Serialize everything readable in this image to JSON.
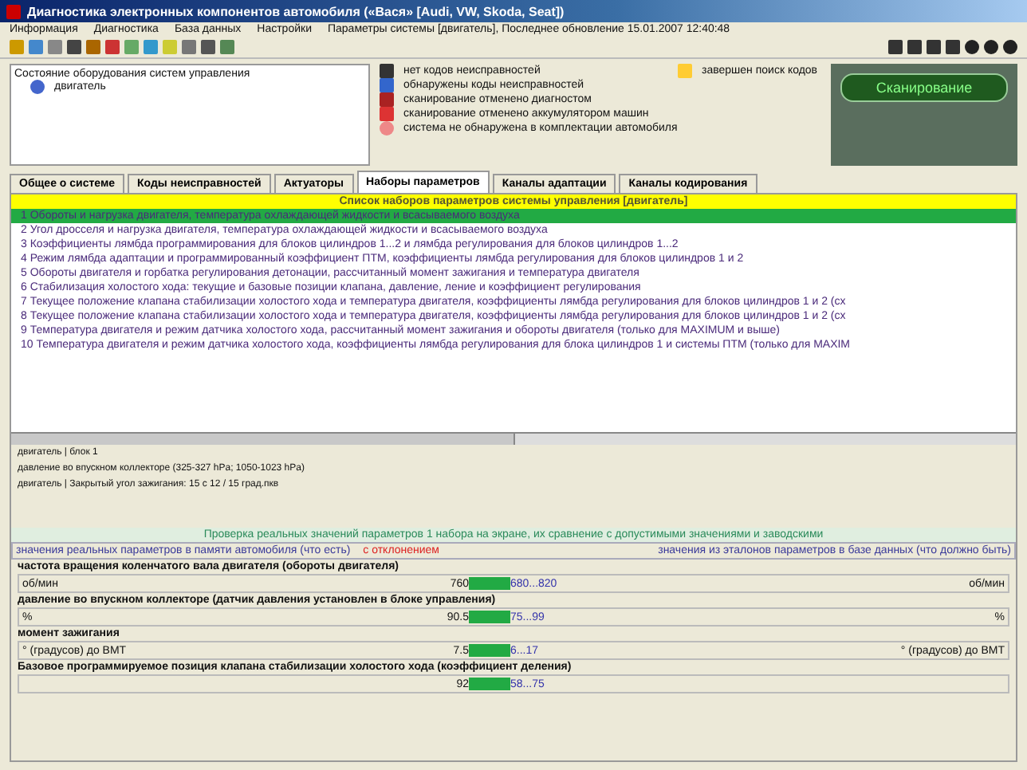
{
  "window": {
    "title": "Диагностика электронных компонентов автомобиля («Вася» [Audi, VW, Skoda, Seat])"
  },
  "menu": [
    "Информация",
    "Диагностика",
    "База данных",
    "Настройки",
    "Параметры системы [двигатель], Последнее обновление 15.01.2007 12:40:48"
  ],
  "systems": {
    "title": "Состояние оборудования систем управления",
    "items": [
      {
        "label": "двигатель"
      }
    ]
  },
  "legend": [
    {
      "kind": "check",
      "label": "нет кодов неисправностей"
    },
    {
      "kind": "found",
      "label": "обнаружены коды неисправностей"
    },
    {
      "kind": "cancel",
      "label": "сканирование отменено диагностом"
    },
    {
      "kind": "battery",
      "label": "сканирование отменено аккумулятором машин"
    },
    {
      "kind": "absent",
      "label": "система не обнаружена в комплектации автомобиля"
    }
  ],
  "legend_extra": {
    "label": "завершен поиск кодов"
  },
  "scan": {
    "button": "Сканирование"
  },
  "tabs": [
    {
      "label": "Общее о системе",
      "selected": false
    },
    {
      "label": "Коды неисправностей",
      "selected": false
    },
    {
      "label": "Актуаторы",
      "selected": false
    },
    {
      "label": "Наборы параметров",
      "selected": true
    },
    {
      "label": "Каналы адаптации",
      "selected": false
    },
    {
      "label": "Каналы кодирования",
      "selected": false
    }
  ],
  "list": {
    "title": "Список наборов параметров системы управления [двигатель]",
    "rows": [
      {
        "number": "1",
        "text": "Обороты и нагрузка двигателя, температура охлаждающей жидкости и всасываемого воздуха",
        "selected": true
      },
      {
        "number": "2",
        "text": "Угол дросселя и нагрузка двигателя, температура охлаждающей жидкости и всасываемого воздуха",
        "selected": false
      },
      {
        "number": "3",
        "text": "Коэффициенты лямбда программирования для блоков цилиндров 1...2 и лямбда регулирования для блоков цилиндров 1...2",
        "selected": false
      },
      {
        "number": "4",
        "text": "Режим лямбда адаптации и программированный коэффициент ПТМ, коэффициенты лямбда регулирования для блоков цилиндров 1 и 2",
        "selected": false
      },
      {
        "number": "5",
        "text": "Обороты двигателя и горбатка регулирования детонации, рассчитанный момент зажигания и температура двигателя",
        "selected": false
      },
      {
        "number": "6",
        "text": "Стабилизация холостого хода: текущие и базовые позиции клапана, давление, ление и коэффициент регулирования",
        "selected": false
      },
      {
        "number": "7",
        "text": "Текущее положение клапана стабилизации холостого хода и температура двигателя, коэффициенты лямбда регулирования для блоков цилиндров 1 и 2 (сх",
        "selected": false
      },
      {
        "number": "8",
        "text": "Текущее положение клапана стабилизации холостого хода и температура двигателя, коэффициенты лямбда регулирования для блоков цилиндров 1 и 2 (сх",
        "selected": false
      },
      {
        "number": "9",
        "text": "Температура двигателя и режим датчика холостого хода, рассчитанный момент зажигания и обороты двигателя (только для MAXIMUM и выше)",
        "selected": false
      },
      {
        "number": "10",
        "text": "Температура двигателя и режим датчика холостого хода, коэффициенты лямбда регулирования для блока цилиндров 1 и системы ПТМ (только для MAXIM",
        "selected": false
      }
    ]
  },
  "info": [
    "двигатель | блок 1",
    "давление во впускном коллекторе (325-327 hPa; 1050-1023 hPa)",
    "двигатель | Закрытый угол зажигания: 15 с 12 / 15 град.пкв"
  ],
  "check_title": "Проверка реальных значений параметров 1 набора на экране, их сравнение с допустимыми значениями и заводскими",
  "columns": {
    "left": "значения реальных параметров в памяти автомобиля (что есть)",
    "deviation": "с отклонением",
    "right": "значения из эталонов параметров в базе данных (что должно быть)"
  },
  "parameters": [
    {
      "name": "частота вращения коленчатого вала двигателя (обороты двигателя)",
      "unit": "об/мин",
      "value": "760",
      "range": "680...820",
      "unit_right": "об/мин"
    },
    {
      "name": "давление во впускном коллекторе (датчик давления установлен в блоке управления)",
      "unit": "%",
      "value": "90.5",
      "range": "75...99",
      "unit_right": "%"
    },
    {
      "name": "момент зажигания",
      "unit": "° (градусов) до ВМТ",
      "value": "7.5",
      "range": "6...17",
      "unit_right": "° (градусов) до ВМТ"
    },
    {
      "name": "Базовое программируемое позиция клапана стабилизации холостого хода (коэффициент деления)",
      "value": "92",
      "range": "58...75"
    }
  ]
}
